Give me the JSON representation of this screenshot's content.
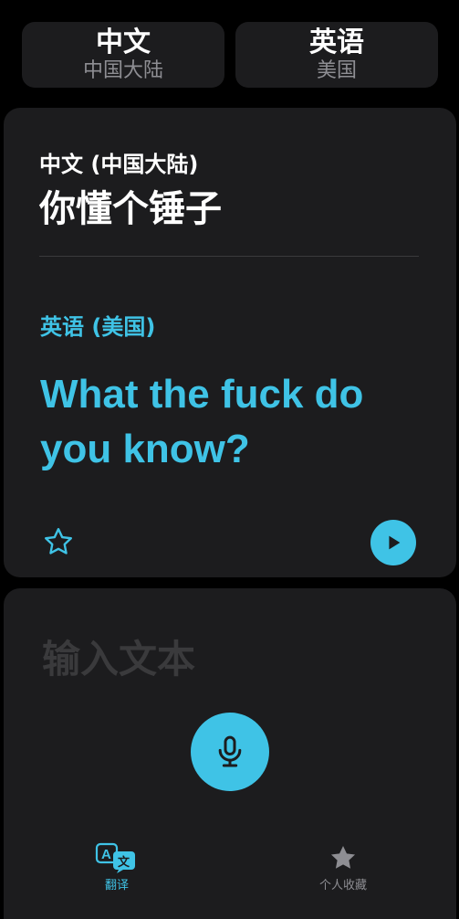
{
  "languages": {
    "source": {
      "name": "中文",
      "region": "中国大陆"
    },
    "target": {
      "name": "英语",
      "region": "美国"
    }
  },
  "result": {
    "source_label": "中文 (中国大陆)",
    "source_text": "你懂个锤子",
    "target_label": "英语 (美国)",
    "target_text": "What the fuck do you know?"
  },
  "input": {
    "placeholder": "输入文本"
  },
  "tabs": [
    {
      "label": "翻译",
      "icon": "translate-icon",
      "active": true
    },
    {
      "label": "个人收藏",
      "icon": "star-icon",
      "active": false
    }
  ],
  "colors": {
    "accent": "#3fc3e6",
    "background": "#000000",
    "card": "#1c1c1e",
    "muted": "#8e8e93"
  },
  "icons": {
    "favorite": "star-outline-icon",
    "play": "play-icon",
    "mic": "microphone-icon"
  }
}
